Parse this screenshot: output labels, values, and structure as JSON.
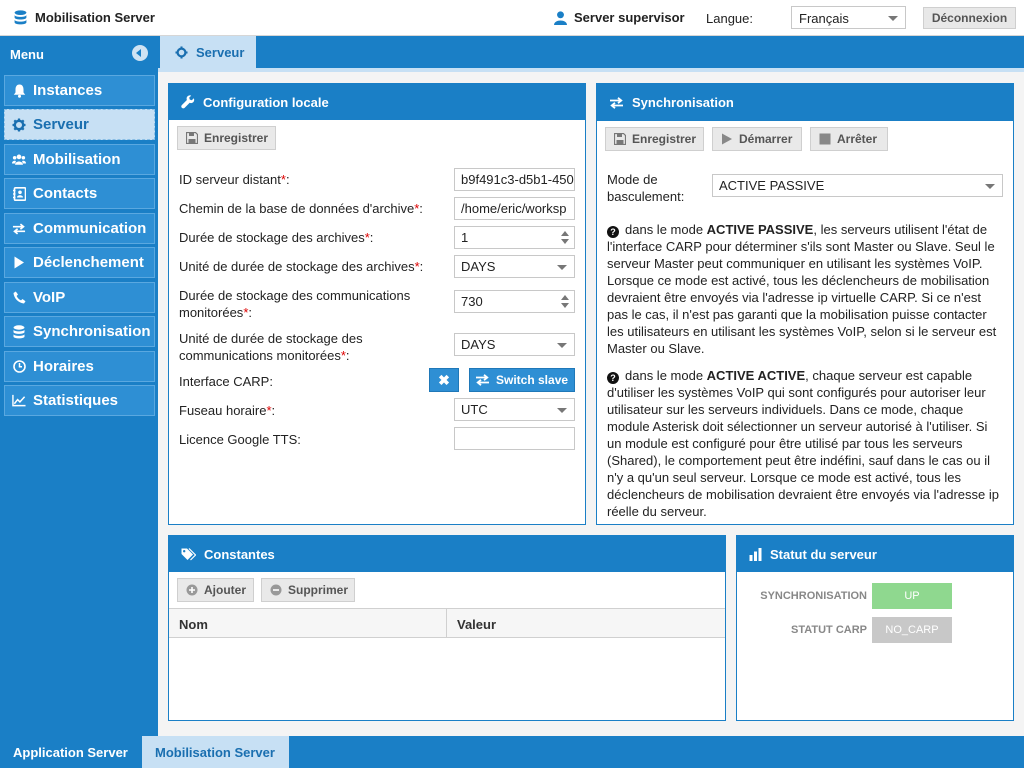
{
  "topbar": {
    "app_title": "Mobilisation Server",
    "user": "Server supervisor",
    "lang_label": "Langue:",
    "lang_value": "Français",
    "logout": "Déconnexion"
  },
  "sidebar": {
    "title": "Menu",
    "items": [
      {
        "label": "Instances",
        "icon": "bell-icon"
      },
      {
        "label": "Serveur",
        "icon": "gear-icon",
        "active": true
      },
      {
        "label": "Mobilisation",
        "icon": "users-icon"
      },
      {
        "label": "Contacts",
        "icon": "address-book-icon"
      },
      {
        "label": "Communication",
        "icon": "arrows-exchange-icon"
      },
      {
        "label": "Déclenchement",
        "icon": "play-icon"
      },
      {
        "label": "VoIP",
        "icon": "phone-icon"
      },
      {
        "label": "Synchronisation",
        "icon": "database-icon"
      },
      {
        "label": "Horaires",
        "icon": "clock-icon"
      },
      {
        "label": "Statistiques",
        "icon": "line-chart-icon"
      }
    ]
  },
  "tab": {
    "label": "Serveur"
  },
  "config": {
    "title": "Configuration locale",
    "save": "Enregistrer",
    "fields": [
      {
        "label": "ID serveur distant",
        "value": "b9f491c3-d5b1-450"
      },
      {
        "label": "Chemin de la base de données d'archive",
        "value": "/home/eric/worksp"
      },
      {
        "label": "Durée de stockage des archives",
        "value": "1"
      },
      {
        "label": "Unité de durée de stockage des archives",
        "value": "DAYS"
      },
      {
        "label": "Durée de stockage des communications monitorées",
        "value": "730"
      },
      {
        "label": "Unité de durée de stockage des communications monitorées",
        "value": "DAYS"
      },
      {
        "label": "Interface CARP:",
        "value": ""
      },
      {
        "label": "Fuseau horaire",
        "value": "UTC"
      },
      {
        "label": "Licence Google TTS:",
        "value": ""
      }
    ],
    "switch_slave": "Switch slave",
    "clear_symbol": "✖"
  },
  "sync": {
    "title": "Synchronisation",
    "save": "Enregistrer",
    "start": "Démarrer",
    "stop": "Arrêter",
    "mode_label": "Mode de basculement:",
    "mode_value": "ACTIVE PASSIVE",
    "desc1_pre": "dans le mode ",
    "desc1_bold": "ACTIVE PASSIVE",
    "desc1_post": ", les serveurs utilisent l'état de l'interface CARP pour déterminer s'ils sont Master ou Slave. Seul le serveur Master peut communiquer en utilisant les systèmes VoIP. Lorsque ce mode est activé, tous les déclencheurs de mobilisation devraient être envoyés via l'adresse ip virtuelle CARP. Si ce n'est pas le cas, il n'est pas garanti que la mobilisation puisse contacter les utilisateurs en utilisant les systèmes VoIP, selon si le serveur est Master ou Slave.",
    "desc2_pre": "dans le mode ",
    "desc2_bold": "ACTIVE ACTIVE",
    "desc2_post": ", chaque serveur est capable d'utiliser les systèmes VoIP qui sont configurés pour autoriser leur utilisateur sur les serveurs individuels. Dans ce mode, chaque module Asterisk doit sélectionner un serveur autorisé à l'utiliser. Si un module est configuré pour être utilisé par tous les serveurs (Shared), le comportement peut être indéfini, sauf dans le cas ou il n'y a qu'un seul serveur. Lorsque ce mode est activé, tous les déclencheurs de mobilisation devraient être envoyés via l'adresse ip réelle du serveur."
  },
  "constants": {
    "title": "Constantes",
    "add": "Ajouter",
    "delete": "Supprimer",
    "col_name": "Nom",
    "col_value": "Valeur"
  },
  "status": {
    "title": "Statut du serveur",
    "sync_label": "SYNCHRONISATION",
    "sync_value": "UP",
    "carp_label": "STATUT CARP",
    "carp_value": "NO_CARP",
    "colors": {
      "up": "#8fd88f",
      "no_carp": "#c8c8c8"
    }
  },
  "bottom_tabs": {
    "app_server": "Application Server",
    "mob_server": "Mobilisation Server"
  }
}
